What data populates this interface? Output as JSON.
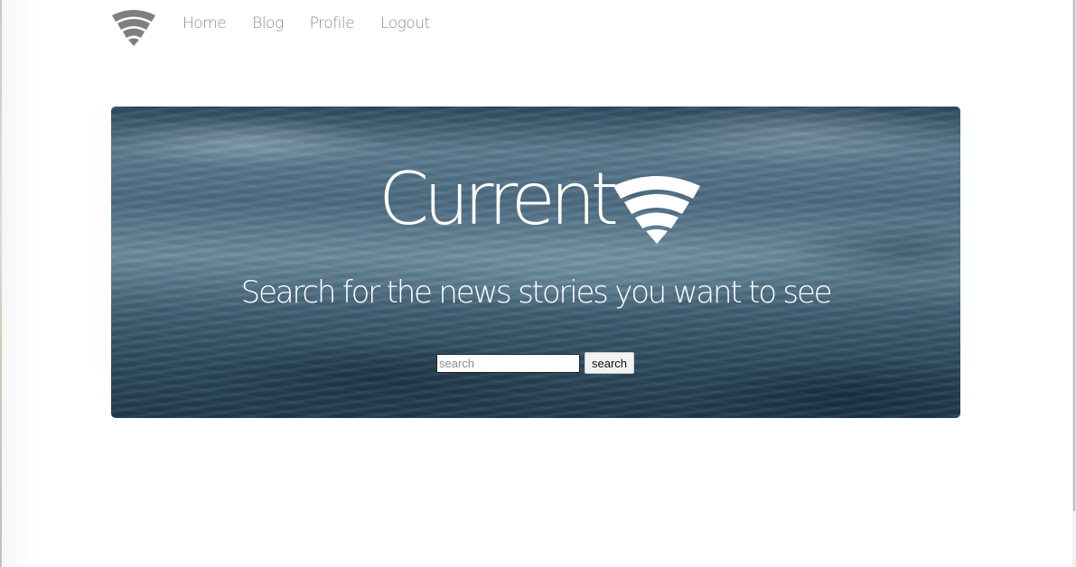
{
  "nav": {
    "logo_icon": "wifi-signal-icon",
    "links": [
      {
        "label": "Home"
      },
      {
        "label": "Blog"
      },
      {
        "label": "Profile"
      },
      {
        "label": "Logout"
      }
    ]
  },
  "hero": {
    "title": "Current",
    "title_icon": "wifi-signal-icon",
    "subtitle": "Search for the news stories you want to see",
    "search": {
      "placeholder": "search",
      "value": "",
      "button_label": "search"
    }
  },
  "colors": {
    "nav_text": "#8a8a8a",
    "logo": "#7f7f7f",
    "hero_text": "#ffffff",
    "hero_water": "#4c6c82"
  }
}
